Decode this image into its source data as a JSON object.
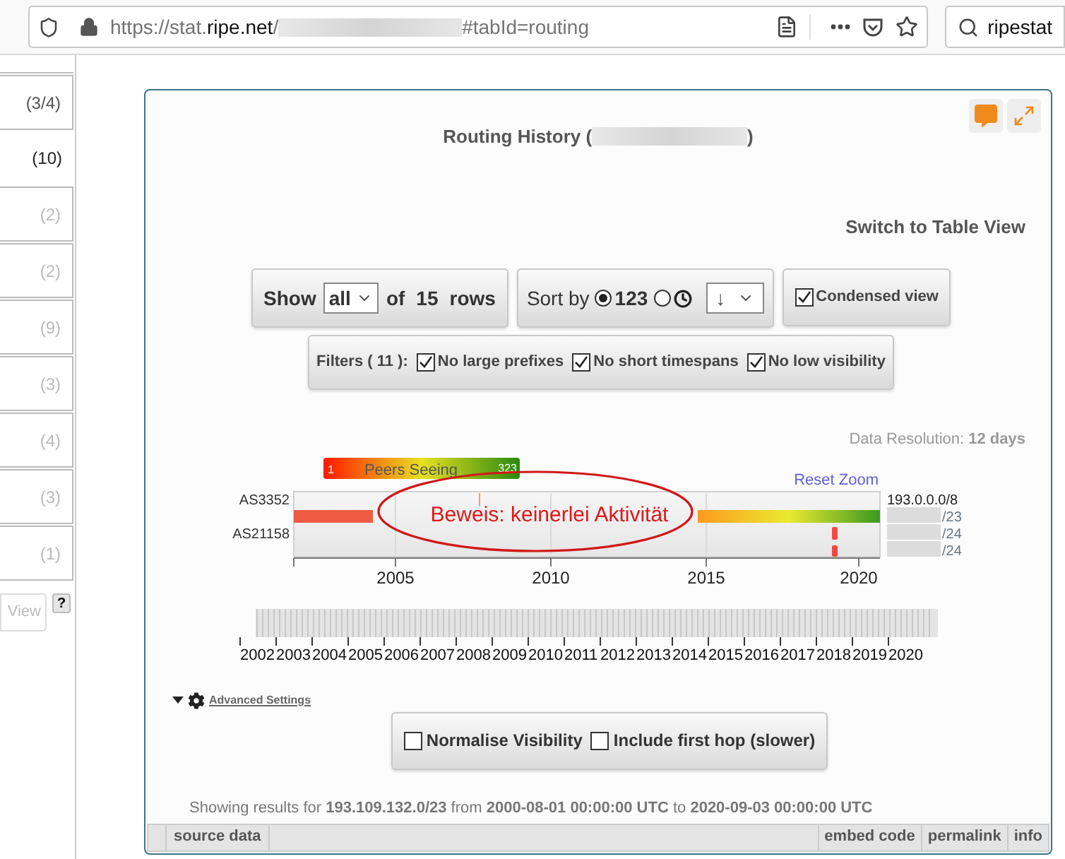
{
  "browser": {
    "url_scheme": "https://stat.",
    "url_domain": "ripe.net",
    "url_slash": "/",
    "url_end": "#tabId=routing",
    "search_value": "ripestat"
  },
  "sidebar": {
    "items": [
      {
        "count": "(3/4)",
        "selected": false,
        "disabled": false
      },
      {
        "count": "(10)",
        "selected": true,
        "disabled": false
      },
      {
        "count": "(2)",
        "selected": false,
        "disabled": true
      },
      {
        "count": "(2)",
        "selected": false,
        "disabled": true
      },
      {
        "count": "(9)",
        "selected": false,
        "disabled": true
      },
      {
        "count": "(3)",
        "selected": false,
        "disabled": true
      },
      {
        "count": "(4)",
        "selected": false,
        "disabled": true
      },
      {
        "count": "(3)",
        "selected": false,
        "disabled": true
      },
      {
        "count": "(1)",
        "selected": false,
        "disabled": true
      }
    ],
    "view_button": "View",
    "help_button": "?"
  },
  "widget": {
    "title_start": "Routing History (",
    "title_end": ")",
    "switch_link": "Switch to Table View",
    "show": {
      "label": "Show",
      "value": "all",
      "of": "of",
      "count": "15",
      "rows": "rows"
    },
    "sort": {
      "label": "Sort by",
      "options": [
        {
          "kind": "number",
          "label": "123",
          "selected": true
        },
        {
          "kind": "clock",
          "selected": false
        }
      ],
      "order": "↓"
    },
    "condensed": {
      "label": "Condensed view",
      "checked": true
    },
    "filters": {
      "label": "Filters (",
      "count": "11",
      "close": "):",
      "items": [
        {
          "label": "No large prefixes",
          "checked": true
        },
        {
          "label": "No short timespans",
          "checked": true
        },
        {
          "label": "No low visibility",
          "checked": true
        }
      ]
    },
    "resolution": {
      "label": "Data Resolution:",
      "value": "12 days"
    },
    "timeline": {
      "legend": {
        "min": "1",
        "label": "Peers Seeing",
        "max": "323"
      },
      "reset": "Reset Zoom",
      "rows": [
        "AS3352",
        "AS21158"
      ],
      "prefixes": [
        {
          "text": "193.0.0.0/8",
          "blurred": false
        },
        {
          "text": "/23",
          "blurred": true
        },
        {
          "text": "/24",
          "blurred": true
        },
        {
          "text": "/24",
          "blurred": true
        }
      ],
      "axis_labels": [
        "2005",
        "2010",
        "2015",
        "2020"
      ],
      "overview_years": [
        "2002",
        "2003",
        "2004",
        "2005",
        "2006",
        "2007",
        "2008",
        "2009",
        "2010",
        "2011",
        "2012",
        "2013",
        "2014",
        "2015",
        "2016",
        "2017",
        "2018",
        "2019",
        "2020"
      ],
      "annotation": "Beweis: keinerlei Aktivität"
    },
    "advanced": {
      "link": "Advanced Settings",
      "expanded": true,
      "options": [
        {
          "label": "Normalise Visibility",
          "checked": false
        },
        {
          "label": "Include first hop (slower)",
          "checked": false
        }
      ]
    },
    "summary": "Showing results for **193.109.132.0/23** from **2000-08-01 00:00:00 UTC** to **2020-09-03 00:00:00 UTC**",
    "footer": {
      "left": [
        "source data"
      ],
      "right": [
        "embed code",
        "permalink",
        "info"
      ]
    }
  }
}
